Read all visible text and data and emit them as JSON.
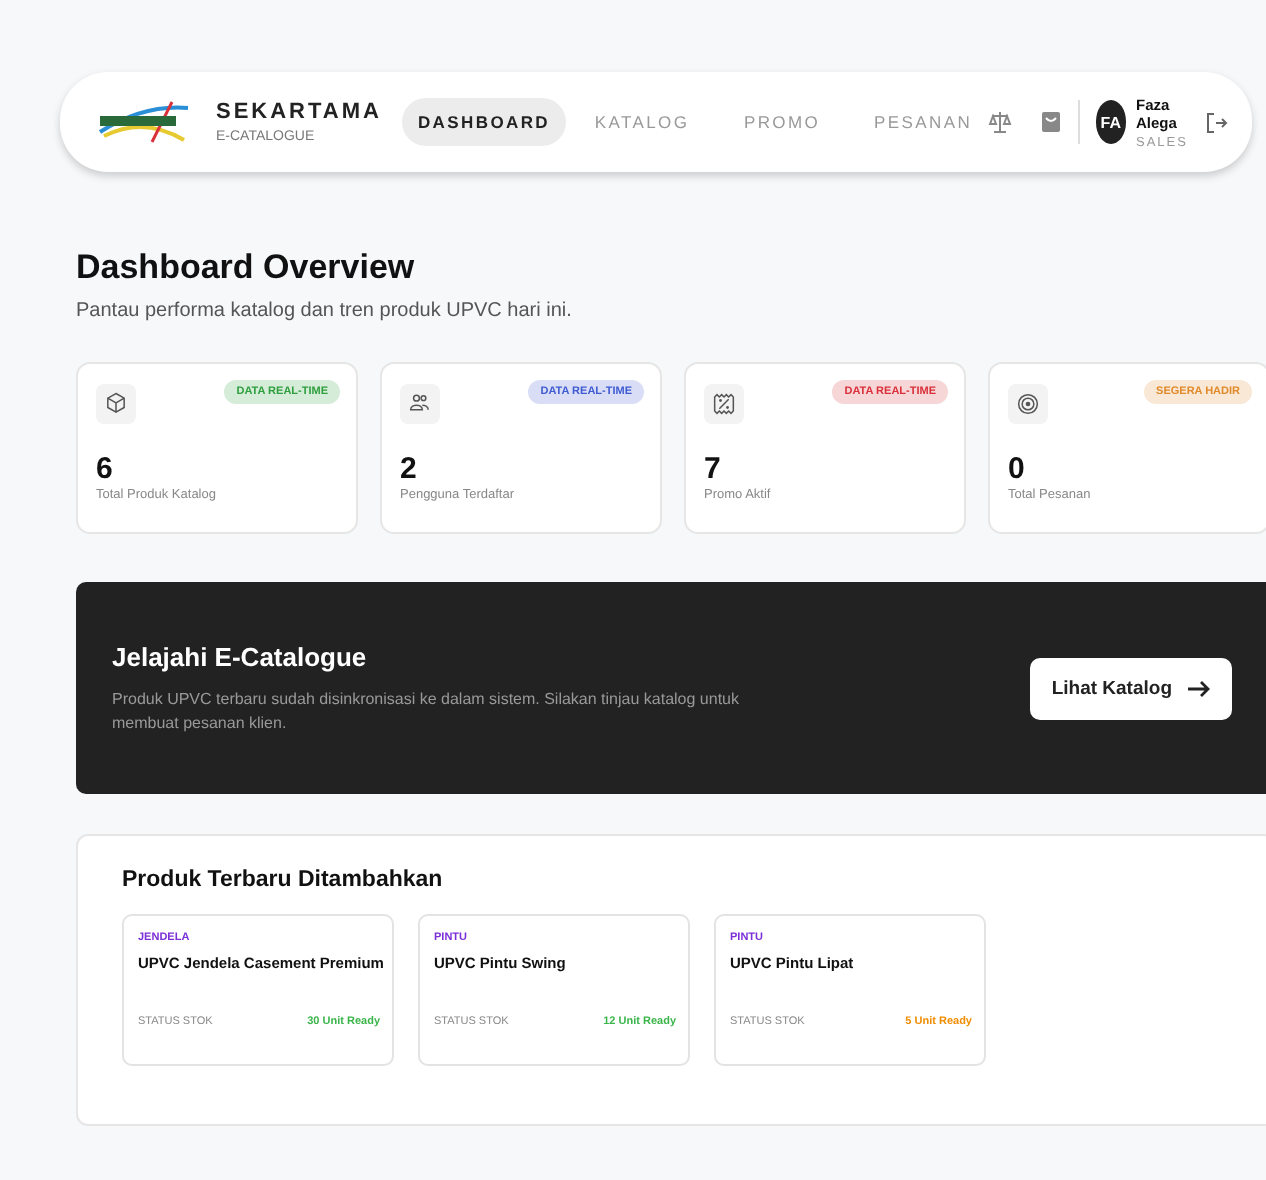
{
  "nav": {
    "brand": "SEKARTAMA",
    "subtitle": "E-CATALOGUE",
    "tabs": [
      {
        "label": "DASHBOARD",
        "selected": true
      },
      {
        "label": "KATALOG",
        "selected": false
      },
      {
        "label": "PROMO",
        "selected": false
      },
      {
        "label": "PESANAN",
        "selected": false
      }
    ],
    "user": {
      "initials": "FA",
      "name": "Faza Alega",
      "role": "SALES"
    }
  },
  "heading": {
    "title": "Dashboard Overview",
    "subtitle": "Pantau performa katalog dan tren produk UPVC hari ini."
  },
  "stats": [
    {
      "badge": "DATA REAL-TIME",
      "color": "#2e9e3e",
      "value": "6",
      "label": "Total Produk Katalog"
    },
    {
      "badge": "DATA REAL-TIME",
      "color": "#3f5bd1",
      "value": "2",
      "label": "Pengguna Terdaftar"
    },
    {
      "badge": "DATA REAL-TIME",
      "color": "#d9303a",
      "value": "7",
      "label": "Promo Aktif"
    },
    {
      "badge": "SEGERA HADIR",
      "color": "#e08a2c",
      "value": "0",
      "label": "Total Pesanan"
    }
  ],
  "banner": {
    "title": "Jelajahi E-Catalogue",
    "text": "Produk UPVC terbaru sudah disinkronisasi ke dalam sistem. Silakan tinjau katalog untuk membuat pesanan klien.",
    "button": "Lihat Katalog"
  },
  "latest": {
    "title": "Produk Terbaru Ditambahkan",
    "products": [
      {
        "category": "JENDELA",
        "name": "UPVC Jendela Casement Premium",
        "status_label": "STATUS STOK",
        "stock": "30 Unit Ready",
        "color": "#3bb54a"
      },
      {
        "category": "PINTU",
        "name": "UPVC Pintu Swing",
        "status_label": "STATUS STOK",
        "stock": "12 Unit Ready",
        "color": "#3bb54a"
      },
      {
        "category": "PINTU",
        "name": "UPVC Pintu Lipat",
        "status_label": "STATUS STOK",
        "stock": "5 Unit Ready",
        "color": "#f08c00"
      }
    ]
  }
}
